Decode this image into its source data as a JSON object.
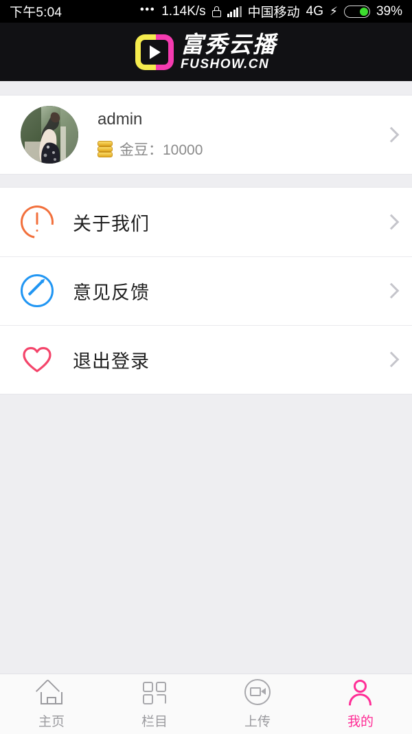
{
  "status_bar": {
    "time": "下午5:04",
    "dots": "•••",
    "network_speed": "1.14K/s",
    "lock_icon": "lock-icon",
    "signal_icon": "signal-bars-icon",
    "carrier": "中国移动",
    "network_type": "4G",
    "charging_icon": "lightning-bolt-icon",
    "battery_percent": "39%",
    "battery_level": 39
  },
  "header": {
    "logo_icon": "fushow-play-logo",
    "brand_cn": "富秀云播",
    "brand_en": "FUSHOW.CN",
    "colors": {
      "yellow": "#f5ec4e",
      "pink": "#f53bb0",
      "background": "#111114"
    }
  },
  "profile": {
    "avatar_icon": "user-avatar-photo",
    "username": "admin",
    "coin_icon": "gold-coin-stack-icon",
    "coin_label": "金豆：10000",
    "chevron_icon": "chevron-right-icon"
  },
  "menu": {
    "items": [
      {
        "icon": "exclamation-circle-icon",
        "label": "关于我们",
        "color": "#f2703c",
        "chevron": "chevron-right-icon"
      },
      {
        "icon": "edit-pen-circle-icon",
        "label": "意见反馈",
        "color": "#2196f3",
        "chevron": "chevron-right-icon"
      },
      {
        "icon": "heart-outline-icon",
        "label": "退出登录",
        "color": "#f4456b",
        "chevron": "chevron-right-icon"
      }
    ]
  },
  "tabbar": {
    "active_color": "#ff2d96",
    "inactive_color": "#9a9a9e",
    "tabs": [
      {
        "icon": "home-icon",
        "label": "主页",
        "active": false
      },
      {
        "icon": "grid-columns-icon",
        "label": "栏目",
        "active": false
      },
      {
        "icon": "video-upload-icon",
        "label": "上传",
        "active": false
      },
      {
        "icon": "person-profile-icon",
        "label": "我的",
        "active": true
      }
    ]
  }
}
